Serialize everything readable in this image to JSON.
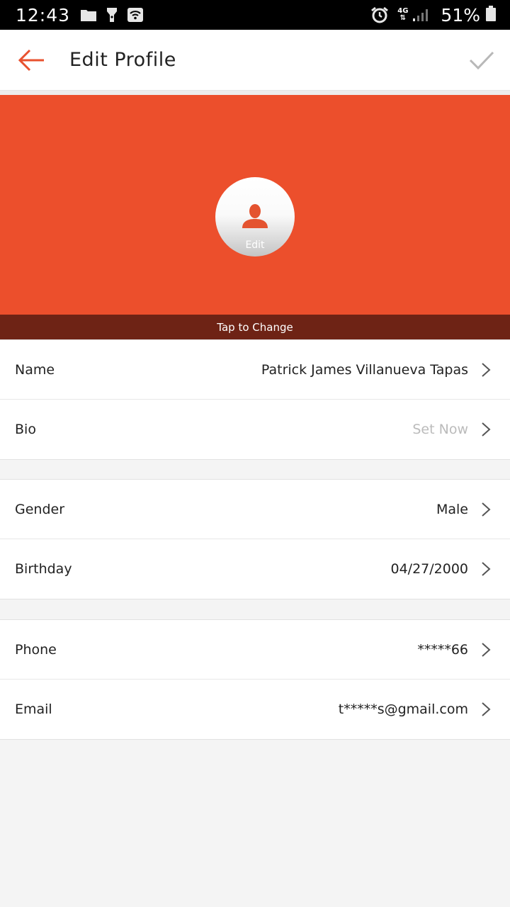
{
  "status_bar": {
    "time": "12:43",
    "network": "4G",
    "battery": "51%"
  },
  "app_bar": {
    "title": "Edit Profile"
  },
  "cover": {
    "avatar_edit_label": "Edit",
    "tap_to_change_label": "Tap to Change",
    "accent_color": "#ec4f2c"
  },
  "profile": {
    "name": {
      "label": "Name",
      "value": "Patrick James Villanueva Tapas"
    },
    "bio": {
      "label": "Bio",
      "value": "Set Now"
    },
    "gender": {
      "label": "Gender",
      "value": "Male"
    },
    "birthday": {
      "label": "Birthday",
      "value": "04/27/2000"
    },
    "phone": {
      "label": "Phone",
      "value": "*****66"
    },
    "email": {
      "label": "Email",
      "value": "t*****s@gmail.com"
    }
  }
}
